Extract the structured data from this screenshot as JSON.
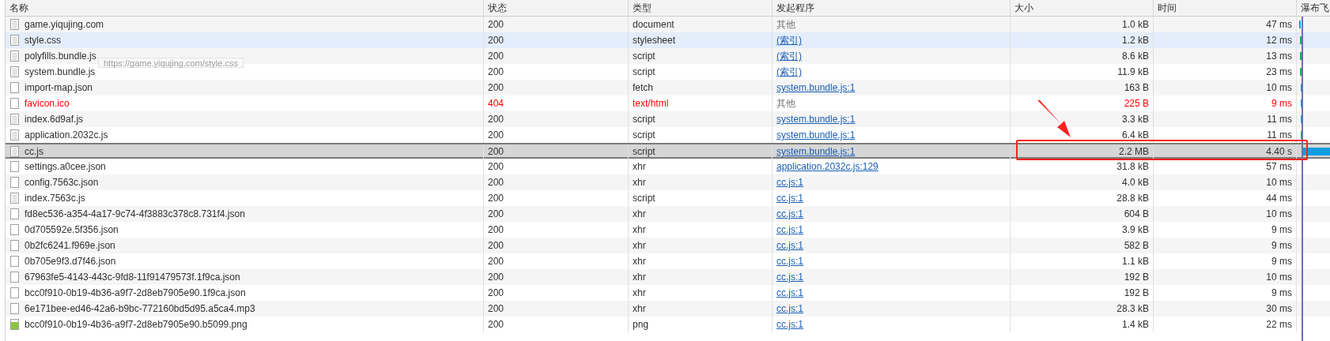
{
  "columns": [
    "名称",
    "状态",
    "类型",
    "发起程序",
    "大小",
    "时间",
    "瀑布飞"
  ],
  "rows": [
    {
      "name": "game.yiqujing.com",
      "kind": "page",
      "status": "200",
      "type": "document",
      "initiator": {
        "kind": "text",
        "text": "其他"
      },
      "size": "1.0 kB",
      "time": "47 ms",
      "error": false,
      "selected": false,
      "hovered": false
    },
    {
      "name": "style.css",
      "kind": "page",
      "status": "200",
      "type": "stylesheet",
      "initiator": {
        "kind": "link",
        "text": "(索引)"
      },
      "size": "1.2 kB",
      "time": "12 ms",
      "error": false,
      "selected": false,
      "hovered": true
    },
    {
      "name": "polyfills.bundle.js",
      "kind": "page",
      "status": "200",
      "type": "script",
      "initiator": {
        "kind": "link",
        "text": "(索引)"
      },
      "size": "8.6 kB",
      "time": "13 ms",
      "error": false,
      "selected": false,
      "hovered": false
    },
    {
      "name": "system.bundle.js",
      "kind": "page",
      "status": "200",
      "type": "script",
      "initiator": {
        "kind": "link",
        "text": "(索引)"
      },
      "size": "11.9 kB",
      "time": "23 ms",
      "error": false,
      "selected": false,
      "hovered": false
    },
    {
      "name": "import-map.json",
      "kind": "blank",
      "status": "200",
      "type": "fetch",
      "initiator": {
        "kind": "link",
        "text": "system.bundle.js:1"
      },
      "size": "163 B",
      "time": "10 ms",
      "error": false,
      "selected": false,
      "hovered": false
    },
    {
      "name": "favicon.ico",
      "kind": "blank",
      "status": "404",
      "type": "text/html",
      "initiator": {
        "kind": "text",
        "text": "其他"
      },
      "size": "225 B",
      "time": "9 ms",
      "error": true,
      "selected": false,
      "hovered": false
    },
    {
      "name": "index.6d9af.js",
      "kind": "page",
      "status": "200",
      "type": "script",
      "initiator": {
        "kind": "link",
        "text": "system.bundle.js:1"
      },
      "size": "3.3 kB",
      "time": "11 ms",
      "error": false,
      "selected": false,
      "hovered": false
    },
    {
      "name": "application.2032c.js",
      "kind": "page",
      "status": "200",
      "type": "script",
      "initiator": {
        "kind": "link",
        "text": "system.bundle.js:1"
      },
      "size": "6.4 kB",
      "time": "11 ms",
      "error": false,
      "selected": false,
      "hovered": false
    },
    {
      "name": "cc.js",
      "kind": "page",
      "status": "200",
      "type": "script",
      "initiator": {
        "kind": "link",
        "text": "system.bundle.js:1"
      },
      "size": "2.2 MB",
      "time": "4.40 s",
      "error": false,
      "selected": true,
      "hovered": false
    },
    {
      "name": "settings.a0cee.json",
      "kind": "blank",
      "status": "200",
      "type": "xhr",
      "initiator": {
        "kind": "link",
        "text": "application.2032c.js:129"
      },
      "size": "31.8 kB",
      "time": "57 ms",
      "error": false,
      "selected": false,
      "hovered": false
    },
    {
      "name": "config.7563c.json",
      "kind": "blank",
      "status": "200",
      "type": "xhr",
      "initiator": {
        "kind": "link",
        "text": "cc.js:1"
      },
      "size": "4.0 kB",
      "time": "10 ms",
      "error": false,
      "selected": false,
      "hovered": false
    },
    {
      "name": "index.7563c.js",
      "kind": "page",
      "status": "200",
      "type": "script",
      "initiator": {
        "kind": "link",
        "text": "cc.js:1"
      },
      "size": "28.8 kB",
      "time": "44 ms",
      "error": false,
      "selected": false,
      "hovered": false
    },
    {
      "name": "fd8ec536-a354-4a17-9c74-4f3883c378c8.731f4.json",
      "kind": "blank",
      "status": "200",
      "type": "xhr",
      "initiator": {
        "kind": "link",
        "text": "cc.js:1"
      },
      "size": "604 B",
      "time": "10 ms",
      "error": false,
      "selected": false,
      "hovered": false
    },
    {
      "name": "0d705592e.5f356.json",
      "kind": "blank",
      "status": "200",
      "type": "xhr",
      "initiator": {
        "kind": "link",
        "text": "cc.js:1"
      },
      "size": "3.9 kB",
      "time": "9 ms",
      "error": false,
      "selected": false,
      "hovered": false
    },
    {
      "name": "0b2fc6241.f969e.json",
      "kind": "blank",
      "status": "200",
      "type": "xhr",
      "initiator": {
        "kind": "link",
        "text": "cc.js:1"
      },
      "size": "582 B",
      "time": "9 ms",
      "error": false,
      "selected": false,
      "hovered": false
    },
    {
      "name": "0b705e9f3.d7f46.json",
      "kind": "blank",
      "status": "200",
      "type": "xhr",
      "initiator": {
        "kind": "link",
        "text": "cc.js:1"
      },
      "size": "1.1 kB",
      "time": "9 ms",
      "error": false,
      "selected": false,
      "hovered": false
    },
    {
      "name": "67963fe5-4143-443c-9fd8-11f91479573f.1f9ca.json",
      "kind": "blank",
      "status": "200",
      "type": "xhr",
      "initiator": {
        "kind": "link",
        "text": "cc.js:1"
      },
      "size": "192 B",
      "time": "10 ms",
      "error": false,
      "selected": false,
      "hovered": false
    },
    {
      "name": "bcc0f910-0b19-4b36-a9f7-2d8eb7905e90.1f9ca.json",
      "kind": "blank",
      "status": "200",
      "type": "xhr",
      "initiator": {
        "kind": "link",
        "text": "cc.js:1"
      },
      "size": "192 B",
      "time": "9 ms",
      "error": false,
      "selected": false,
      "hovered": false
    },
    {
      "name": "6e171bee-ed46-42a6-b9bc-772160bd5d95.a5ca4.mp3",
      "kind": "blank",
      "status": "200",
      "type": "xhr",
      "initiator": {
        "kind": "link",
        "text": "cc.js:1"
      },
      "size": "28.3 kB",
      "time": "30 ms",
      "error": false,
      "selected": false,
      "hovered": false
    },
    {
      "name": "bcc0f910-0b19-4b36-a9f7-2d8eb7905e90.b5099.png",
      "kind": "image",
      "status": "200",
      "type": "png",
      "initiator": {
        "kind": "link",
        "text": "cc.js:1"
      },
      "size": "1.4 kB",
      "time": "22 ms",
      "error": false,
      "selected": false,
      "hovered": false
    }
  ],
  "tooltip": "https://game.yiqujing.com/style.css"
}
